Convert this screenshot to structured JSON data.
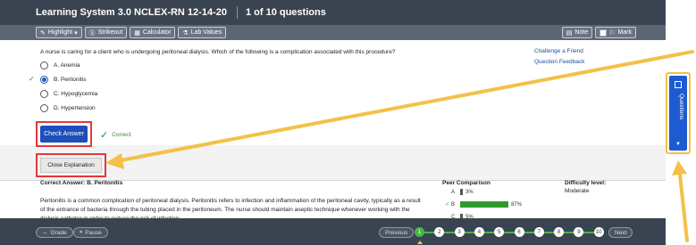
{
  "title": {
    "course": "Learning System 3.0 NCLEX-RN 12-14-20",
    "counter": "1 of 10 questions"
  },
  "toolbar": {
    "highlight": "Highlight",
    "strikeout": "Strikeout",
    "calculator": "Calculator",
    "lab_values": "Lab Values",
    "note": "Note",
    "mark": "Mark"
  },
  "question": {
    "stem": "A nurse is caring for a client who is undergoing peritoneal dialysis. Which of the following is a complication associated with this procedure?",
    "options": [
      {
        "label": "A. Anemia",
        "selected": false
      },
      {
        "label": "B. Peritonitis",
        "selected": true
      },
      {
        "label": "C. Hypoglycemia",
        "selected": false
      },
      {
        "label": "D. Hypertension",
        "selected": false
      }
    ],
    "check_answer": "Check Answer",
    "result": "Correct",
    "close_explanation": "Close Explanation"
  },
  "links": {
    "challenge": "Challenge a Friend",
    "feedback": "Question Feedback"
  },
  "explanation": {
    "correct_answer": "Correct Answer: B. Peritonitis",
    "text": "Peritonitis is a common complication of peritoneal dialysis. Peritonitis refers to infection and inflammation of the peritoneal cavity, typically as a result of the entrance of bacteria through the tubing placed in the peritoneum. The nurse should maintain aseptic technique whenever working with the dialysis catheter in order to reduce the risk of infection."
  },
  "peer": {
    "title": "Peer Comparison",
    "rows": [
      {
        "label": "A",
        "pct": 3,
        "text": "3%",
        "correct": false
      },
      {
        "label": "B",
        "pct": 87,
        "text": "87%",
        "correct": true
      },
      {
        "label": "C",
        "pct": 5,
        "text": "5%",
        "correct": false
      }
    ]
  },
  "difficulty": {
    "title": "Difficulty level:",
    "value": "Moderate"
  },
  "bottom": {
    "grade": "Grade",
    "pause": "Pause",
    "previous": "Previous",
    "next": "Next",
    "pages": [
      "1",
      "2",
      "3",
      "4",
      "5",
      "6",
      "7",
      "8",
      "9",
      "10"
    ],
    "current_page": 1
  },
  "side_panel": {
    "label": "Questions"
  },
  "colors": {
    "annotation_arrow": "#f4c04a",
    "highlight_box": "#e0393b",
    "accent_blue": "#1d4fbb",
    "correct_green": "#2e9a2e"
  }
}
